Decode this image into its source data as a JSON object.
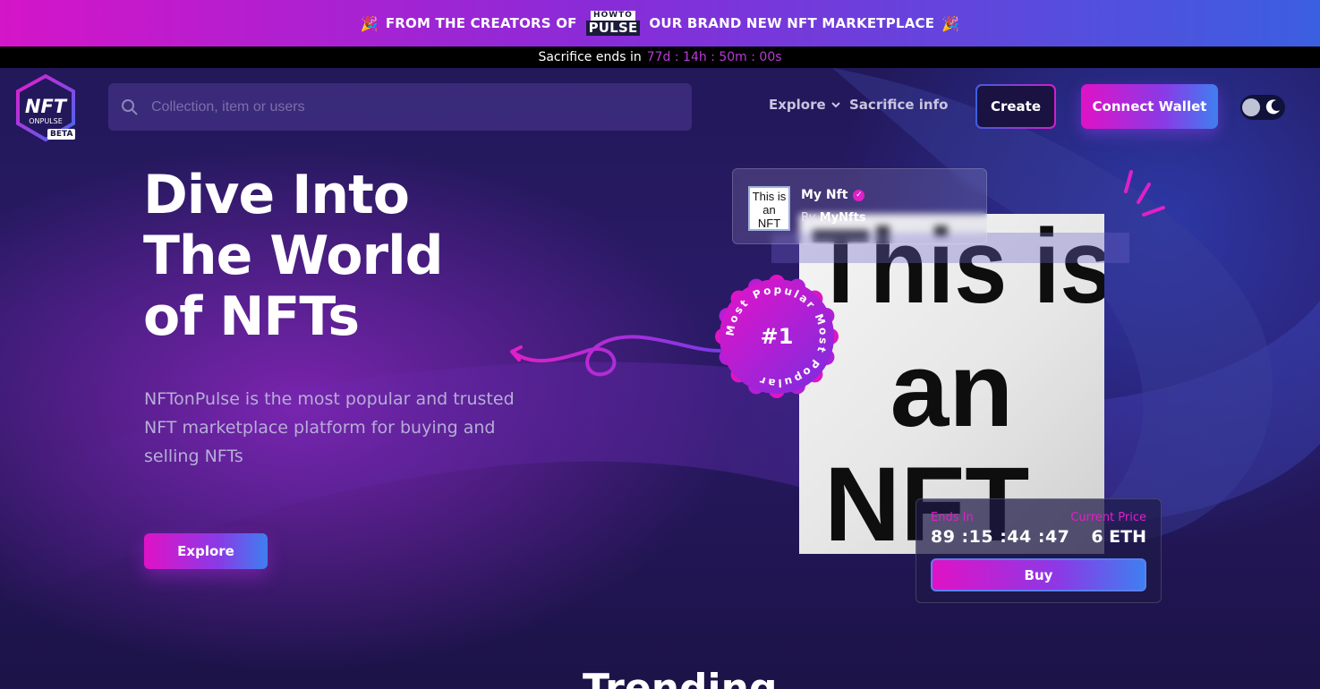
{
  "promo": {
    "left_emoji": "🎉",
    "text_before": "FROM THE CREATORS OF",
    "brand_small": "HOWTO",
    "brand_big": "PULSE",
    "text_after": "OUR BRAND NEW NFT MARKETPLACE",
    "right_emoji": "🎉"
  },
  "countdown": {
    "label": "Sacrifice ends in",
    "timer": "77d : 14h : 50m : 00s"
  },
  "header": {
    "logo_text": "NFT",
    "logo_sub": "ONPULSE",
    "beta": "BETA",
    "search_placeholder": "Collection, item or users",
    "nav_explore": "Explore",
    "nav_sacrifice": "Sacrifice info",
    "create": "Create",
    "connect": "Connect Wallet"
  },
  "hero": {
    "headline": [
      "Dive Into",
      "The World",
      "of NFTs"
    ],
    "description": "NFTonPulse is the most popular and trusted NFT marketplace platform for buying and selling NFTs",
    "explore_button": "Explore"
  },
  "featured": {
    "art_lines": [
      "This is",
      "an",
      "NFT"
    ],
    "thumb_text": "This is an NFT",
    "name": "My Nft",
    "by_label": "By",
    "creator": "MyNfts",
    "badge_number": "#1",
    "badge_ring": "Most Popular Most Popular",
    "ends_label": "Ends In",
    "ends_value": "89 :15 :44 :47",
    "price_label": "Current Price",
    "price_value": "6 ETH",
    "buy": "Buy"
  },
  "sections": {
    "trending": "Trending"
  },
  "colors": {
    "accent_pink": "#e012c6",
    "accent_blue": "#3f7ff0",
    "background": "#1a1240"
  }
}
